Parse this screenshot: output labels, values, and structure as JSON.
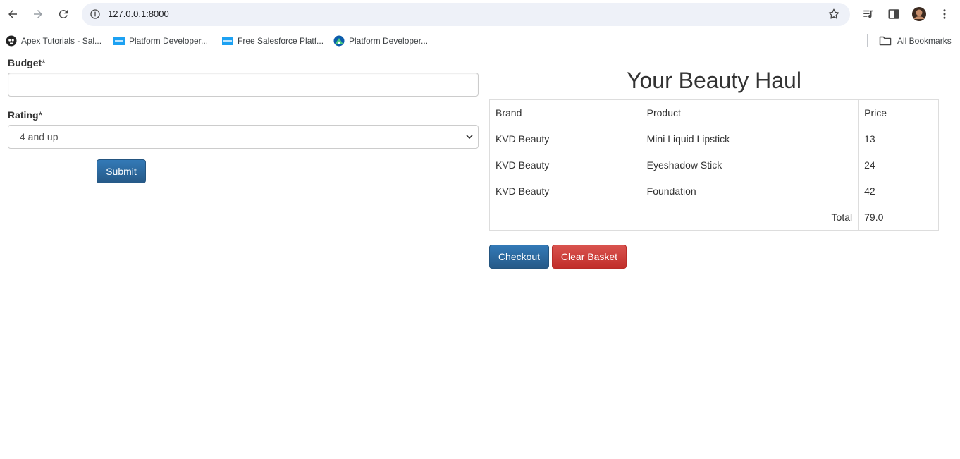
{
  "browser": {
    "url": "127.0.0.1:8000",
    "bookmarks": [
      {
        "label": "Apex Tutorials - Sal..."
      },
      {
        "label": "Platform Developer..."
      },
      {
        "label": "Free Salesforce Platf..."
      },
      {
        "label": "Platform Developer..."
      }
    ],
    "all_bookmarks_label": "All Bookmarks"
  },
  "form": {
    "budget_label": "Budget",
    "budget_required": "*",
    "budget_value": "",
    "rating_label": "Rating",
    "rating_required": "*",
    "rating_selected": "4 and up",
    "submit_label": "Submit"
  },
  "haul": {
    "title": "Your Beauty Haul",
    "headers": [
      "Brand",
      "Product",
      "Price"
    ],
    "rows": [
      [
        "KVD Beauty",
        "Mini Liquid Lipstick",
        "13"
      ],
      [
        "KVD Beauty",
        "Eyeshadow Stick",
        "24"
      ],
      [
        "KVD Beauty",
        "Foundation",
        "42"
      ]
    ],
    "total_label": "Total",
    "total_value": "79.0",
    "checkout_label": "Checkout",
    "clear_label": "Clear Basket"
  },
  "colors": {
    "primary": "#337ab7",
    "danger": "#d9534f"
  }
}
